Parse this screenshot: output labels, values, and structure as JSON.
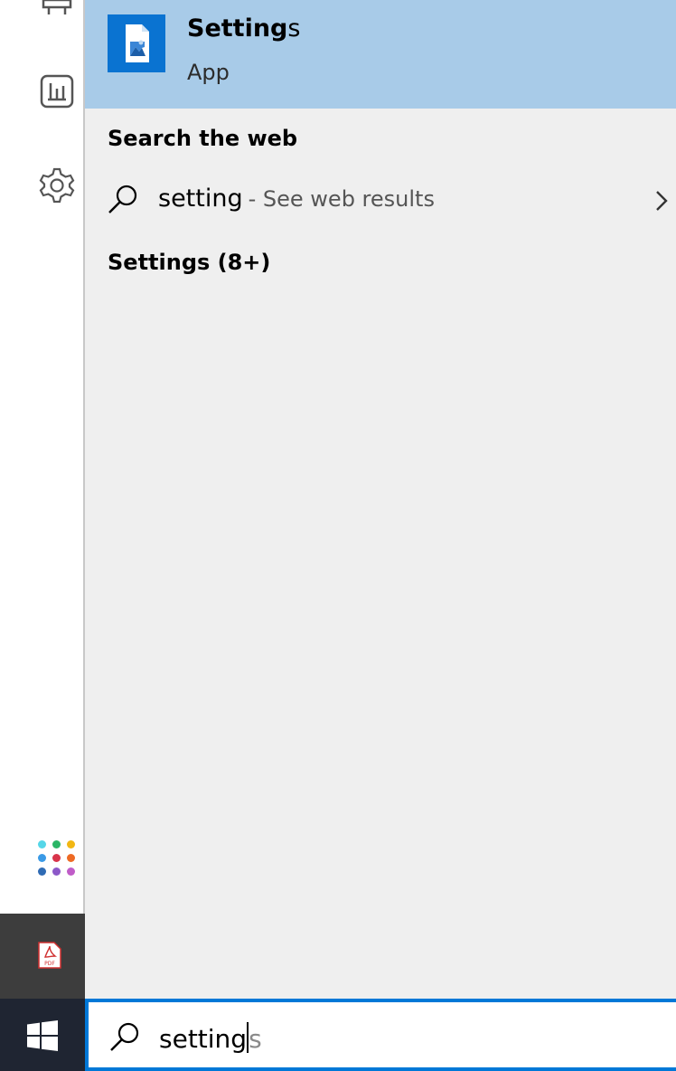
{
  "best_match": {
    "title_typed": "Setting",
    "title_rest": "s",
    "type": "App"
  },
  "web_section": {
    "heading": "Search the web",
    "query": "setting",
    "hint": "- See web results"
  },
  "settings_section": {
    "heading": "Settings (8+)"
  },
  "search_box": {
    "typed": "setting",
    "suggestion": "s"
  },
  "icons": {
    "rail": [
      "store-icon",
      "reports-icon",
      "gear-icon"
    ],
    "apps_grid": "apps-grid-icon",
    "pinned": "pdf-icon",
    "start": "windows-logo-icon"
  },
  "colors": {
    "accent": "#0078d7",
    "best_match_bg": "#a8cbe8",
    "panel_bg": "#efefef",
    "taskbar": "#1f2532"
  }
}
